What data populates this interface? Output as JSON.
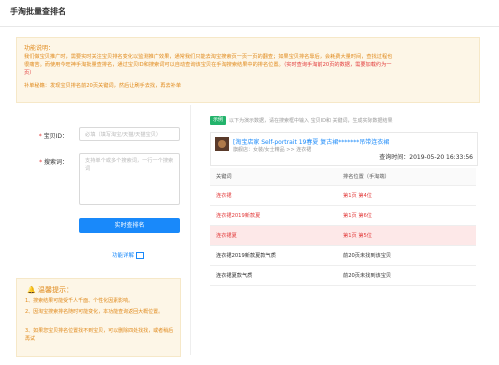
{
  "header": {
    "title": "手淘批量查排名"
  },
  "info": {
    "title": "功能说明：",
    "line1": "我们做宝贝推广时，需要实时关注宝贝排名变化以监测推广效果，通常我们只能去淘宝搜索页一页一页的翻查；如果宝贝排名靠后，会耗费大量时间，查找过程也",
    "line2": "很痛苦。而使用今旺神手淘批量查排名，通过宝贝ID和搜索词可以自动查询该宝贝在手淘搜索结果中的排名位置。",
    "line2_red": "（实时查询手淘前20页的数据，需要加载约为一",
    "line3_red": "页）",
    "tip": "补单秘籍：发现宝贝排名前20页关键词，然后让刷手去找，再去补单"
  },
  "form": {
    "id_label": "宝贝ID：",
    "id_placeholder": "必填（填写淘宝/天猫/天猫宝贝）",
    "keywords_label": "搜索词：",
    "keywords_placeholder": "支持单个或多个搜索词，一行一个搜索词",
    "submit_label": "实时查排名",
    "help_link": "功能详解"
  },
  "warning": {
    "title": "温馨提示：",
    "items": [
      "1、搜索结果可能受千人千面、个性化因素影响。",
      "2、因淘宝搜索排名随时可能变化，本功能查询返回大概位置。",
      "3、如果您宝贝排名位置找不到宝贝，可以删除四处找找，或者稍后再试"
    ]
  },
  "example": {
    "tag": "示例",
    "text": "以下为演示数据，请在搜索框中输入 宝贝ID和 关键词，生成实际数据结果"
  },
  "product": {
    "title": "[淘宝店家 Self-portrait 19春夏 复古裙*******吊带连衣裙",
    "shop": "旗舰店：女装/女士精品 >> 连衣裙",
    "query_time": "查询时间：2019-05-20 16:33:56"
  },
  "results": {
    "headers": [
      "关键词",
      "排名位置（手淘端）"
    ],
    "rows": [
      {
        "keyword": "连衣裙",
        "rank": "第1页 第4位"
      },
      {
        "keyword": "连衣裙2019新款夏",
        "rank": "第1页 第6位"
      },
      {
        "keyword": "连衣裙夏",
        "rank": "第1页 第5位"
      },
      {
        "keyword": "连衣裙2019新款夏款气质",
        "rank": "前20页未找到该宝贝"
      },
      {
        "keyword": "连衣裙夏款气质",
        "rank": "前20页未找到该宝贝"
      }
    ]
  }
}
